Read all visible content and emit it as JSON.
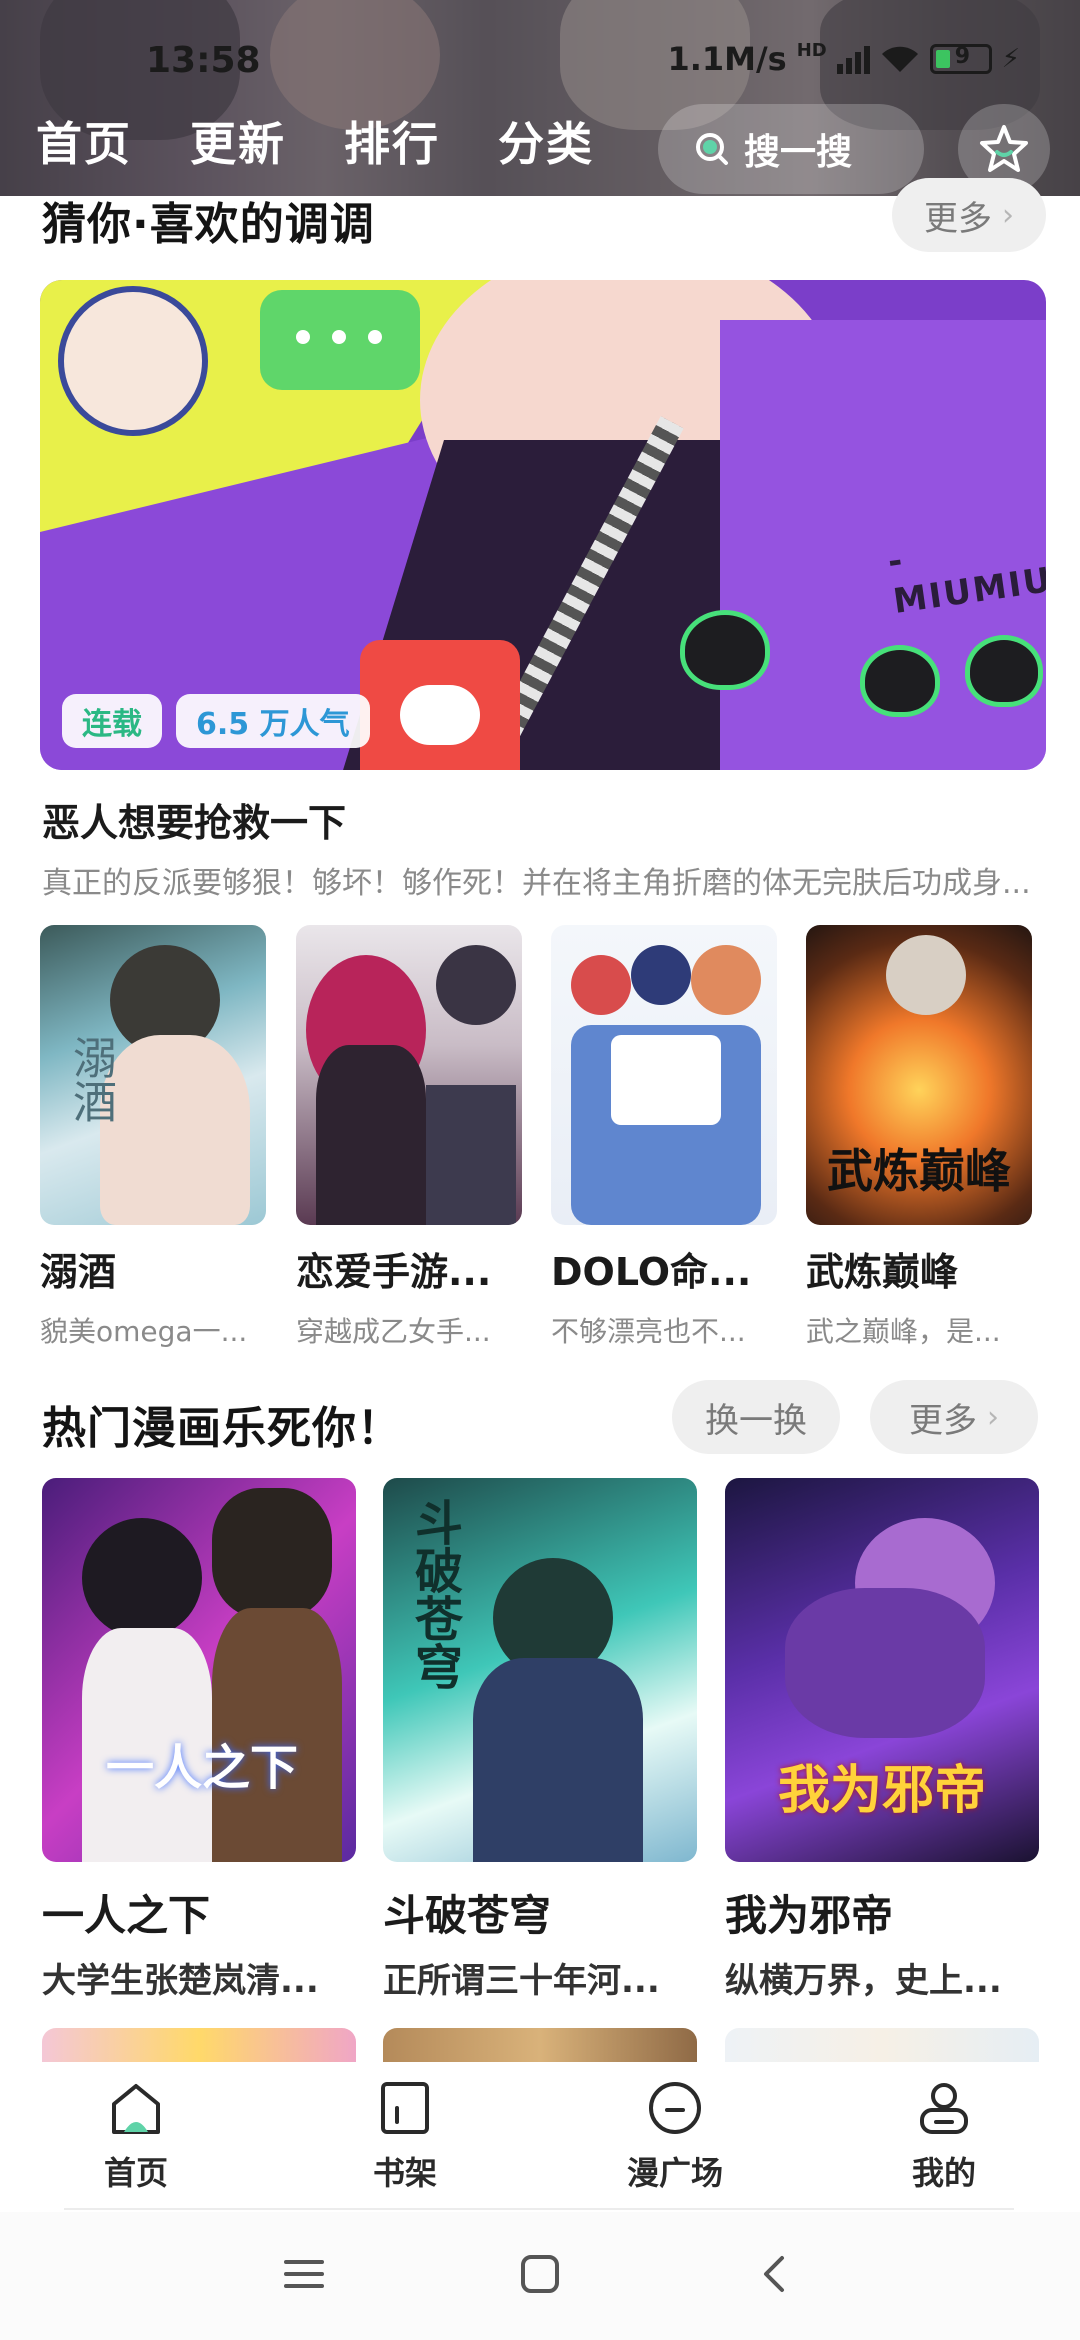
{
  "status_bar": {
    "time": "13:58",
    "network_speed": "1.1M/s",
    "network_type": "HD",
    "battery_level": "9"
  },
  "top_nav": {
    "tabs": [
      {
        "label": "首页"
      },
      {
        "label": "更新"
      },
      {
        "label": "排行"
      },
      {
        "label": "分类"
      }
    ],
    "search_label": "搜一搜"
  },
  "section_guess": {
    "title": "猜你·喜欢的调调",
    "more_label": "更多",
    "feature": {
      "badge_status": "连载",
      "badge_popularity": "6.5 万人气",
      "cover_text": "-MIUMIU-",
      "title": "恶人想要抢救一下",
      "description": "真正的反派要够狠！够坏！够作死！并在将主角折磨的体无完肤后功成身..."
    },
    "items": [
      {
        "title": "溺酒",
        "desc": "貌美omega一...",
        "cover_text": "溺酒"
      },
      {
        "title": "恋爱手游...",
        "desc": "穿越成乙女手..."
      },
      {
        "title": "DOLO命...",
        "desc": "不够漂亮也不..."
      },
      {
        "title": "武炼巅峰",
        "desc": "武之巅峰，是...",
        "cover_text": "武炼巅峰"
      }
    ]
  },
  "section_hot": {
    "title": "热门漫画乐死你！",
    "refresh_label": "换一换",
    "more_label": "更多",
    "items": [
      {
        "title": "一人之下",
        "desc": "大学生张楚岚清...",
        "cover_text": "一人之下"
      },
      {
        "title": "斗破苍穹",
        "desc": "正所谓三十年河...",
        "cover_text": "斗破苍穹"
      },
      {
        "title": "我为邪帝",
        "desc": "纵横万界，史上...",
        "cover_text": "我为邪帝"
      }
    ]
  },
  "bottom_tabs": [
    {
      "label": "首页",
      "icon": "home-icon",
      "active": true
    },
    {
      "label": "书架",
      "icon": "bookshelf-icon"
    },
    {
      "label": "漫广场",
      "icon": "plaza-icon"
    },
    {
      "label": "我的",
      "icon": "profile-icon"
    }
  ],
  "colors": {
    "accent": "#5fd3a8",
    "badge_green": "#2bb884",
    "badge_blue": "#2d97d6",
    "pill_bg": "#efefef"
  }
}
